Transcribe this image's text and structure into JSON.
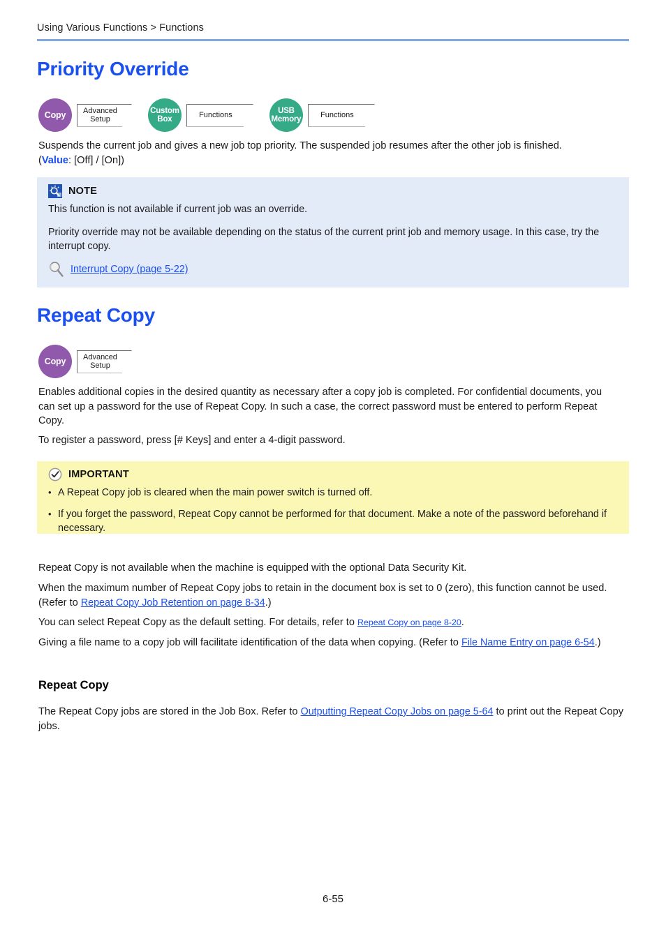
{
  "header": {
    "breadcrumb": "Using Various Functions > Functions",
    "rule_color": "#7fa8e2"
  },
  "colors": {
    "heading_blue": "#1a4ff0",
    "link_blue": "#1a4ff0",
    "copy_badge_purple": "#9159ab",
    "box_badge_green": "#34ab86",
    "note_background": "#e3eaf8",
    "important_background": "#fbf8b6"
  },
  "sections": [
    {
      "title": "Priority Override",
      "badges": [
        {
          "circle_label": "Copy",
          "circle_color": "purple",
          "tag_label": "Advanced\nSetup"
        },
        {
          "circle_label": "Custom\nBox",
          "circle_color": "green",
          "tag_label": "Functions"
        },
        {
          "circle_label": "USB\nMemory",
          "circle_color": "green",
          "tag_label": "Functions"
        }
      ],
      "description_line1": "Suspends the current job and gives a new job top priority. The suspended job resumes after the other job is finished.",
      "description_value_prefix": "(",
      "description_value_label": "Value",
      "description_value_rest": ": [Off] / [On])"
    },
    {
      "title": "Repeat Copy",
      "badges": [
        {
          "circle_label": "Copy",
          "circle_color": "purple",
          "tag_label": "Advanced\nSetup"
        }
      ],
      "description": "Enables additional copies in the desired quantity as necessary after a copy job is completed. For confidential documents, you can set up a password for the use of Repeat Copy. In such a case, the correct password must be entered to perform Repeat Copy.",
      "password_note": "To register a password, press [# Keys] and enter a 4-digit password."
    }
  ],
  "note_box": {
    "icon": "note-icon",
    "label": "NOTE",
    "paragraph1": "This function is not available if current job was an override.",
    "paragraph2": "Priority override may not be available depending on the status of the current print job and memory usage. In this case, try the interrupt copy.",
    "reference_link": "Interrupt Copy (page 5-22)"
  },
  "important_box": {
    "icon": "check-circle-icon",
    "label": "IMPORTANT",
    "bullet_marker": "•",
    "bullets": [
      "A Repeat Copy job is cleared when the main power switch is turned off.",
      "If you forget the password, Repeat Copy cannot be performed for that document. Make a note of the password beforehand if necessary."
    ]
  },
  "after_notes": {
    "line1": "Repeat Copy is not available when the machine is equipped with the optional Data Security Kit.",
    "line2_before": "When the maximum number of Repeat Copy jobs to retain in the document box is set to 0 (zero), this function cannot be used. (Refer to ",
    "line2_link": "Repeat Copy Job Retention on page 8-34",
    "line2_after": ".)",
    "line3_before": "You can select Repeat Copy as the default setting. For details, refer to ",
    "line3_link": "Repeat Copy on page 8-20",
    "line3_after": ".",
    "line4_before": "Giving a file name to a copy job will facilitate identification of the data when copying. (Refer to ",
    "line4_link": "File Name Entry on page 6-54",
    "line4_after": ".)"
  },
  "subsection": {
    "title": "Repeat Copy",
    "text_before": "The Repeat Copy jobs are stored in the Job Box. Refer to ",
    "link": "Outputting Repeat Copy Jobs on page 5-64",
    "text_after": " to print out the Repeat Copy jobs."
  },
  "footer": {
    "page_number": "6-55"
  }
}
